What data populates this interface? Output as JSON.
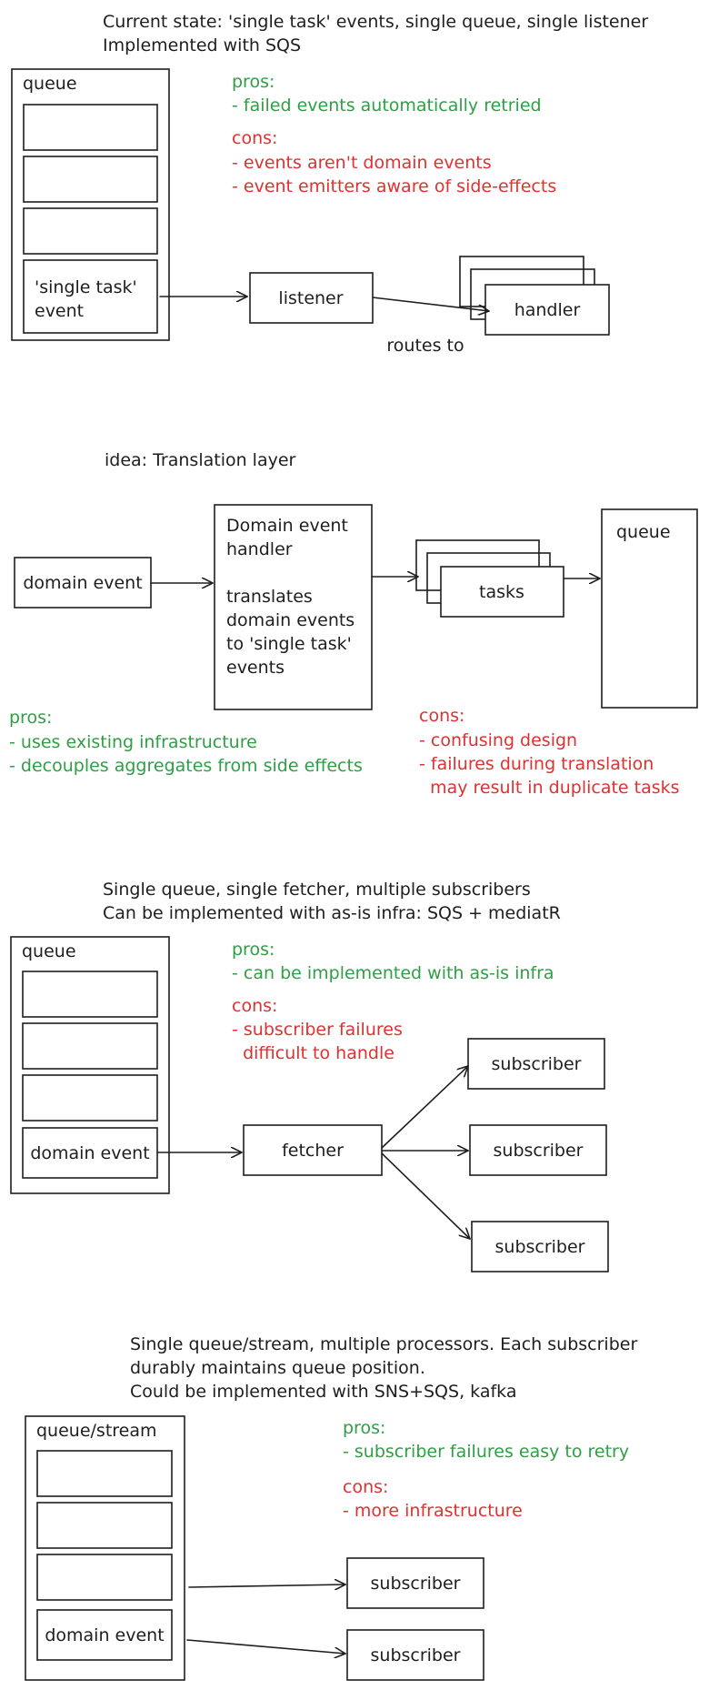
{
  "section1": {
    "title_line1": "Current state: 'single task' events, single queue, single listener",
    "title_line2": "Implemented with SQS",
    "queue_label": "queue",
    "event_line1": "'single task'",
    "event_line2": "event",
    "listener": "listener",
    "handler": "handler",
    "routes_to": "routes to",
    "pros_heading": "pros:",
    "pros": [
      "- failed events automatically retried"
    ],
    "cons_heading": "cons:",
    "cons": [
      "- events aren't domain events",
      "- event emitters aware of side-effects"
    ]
  },
  "section2": {
    "title": "idea: Translation layer",
    "domain_event": "domain event",
    "handler_lines": [
      "Domain event",
      "handler",
      "",
      "translates",
      "domain events",
      "to 'single task'",
      "events"
    ],
    "tasks": "tasks",
    "queue_label": "queue",
    "pros_heading": "pros:",
    "pros": [
      "- uses existing infrastructure",
      "- decouples aggregates from side effects"
    ],
    "cons_heading": "cons:",
    "cons": [
      "- confusing design",
      "- failures during translation",
      "  may result in duplicate tasks"
    ]
  },
  "section3": {
    "title_line1": "Single queue, single fetcher, multiple subscribers",
    "title_line2": "Can be implemented with as-is infra: SQS + mediatR",
    "queue_label": "queue",
    "domain_event": "domain event",
    "fetcher": "fetcher",
    "subscribers": [
      "subscriber",
      "subscriber",
      "subscriber"
    ],
    "pros_heading": "pros:",
    "pros": [
      "- can be implemented with as-is infra"
    ],
    "cons_heading": "cons:",
    "cons": [
      "- subscriber failures",
      "  difficult to handle"
    ]
  },
  "section4": {
    "title_line1": "Single queue/stream, multiple processors. Each subscriber",
    "title_line2": "durably maintains queue position.",
    "title_line3": "Could be implemented with SNS+SQS, kafka",
    "queue_label": "queue/stream",
    "domain_event": "domain event",
    "subscribers": [
      "subscriber",
      "subscriber"
    ],
    "pros_heading": "pros:",
    "pros": [
      "- subscriber failures easy to retry"
    ],
    "cons_heading": "cons:",
    "cons": [
      "- more infrastructure"
    ]
  },
  "colors": {
    "ink": "#1e1e1e",
    "pros": "#2f9e44",
    "cons": "#e03131"
  }
}
